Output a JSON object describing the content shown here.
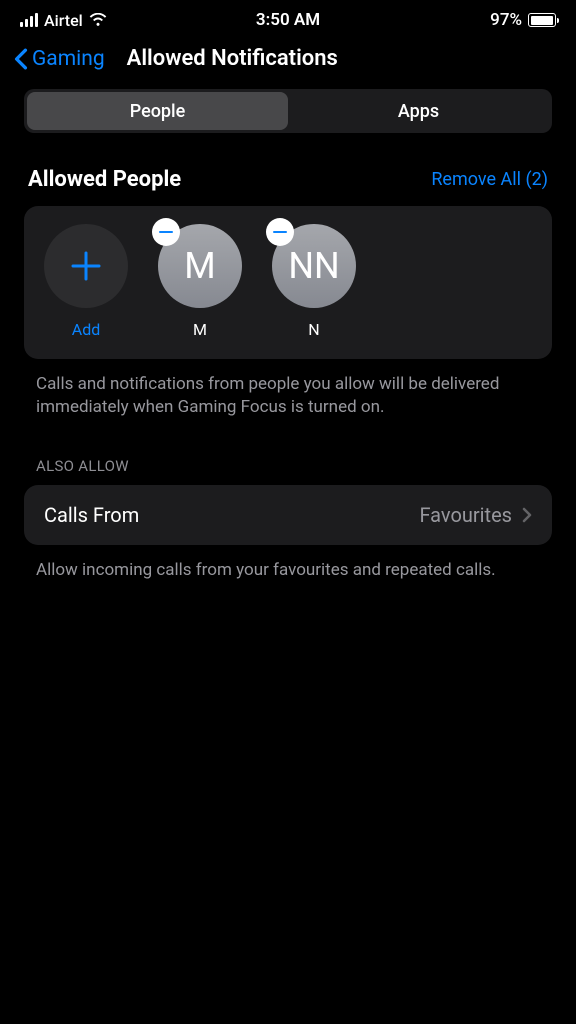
{
  "status": {
    "carrier": "Airtel",
    "time": "3:50 AM",
    "battery_pct": "97%",
    "battery_fill_width": "97%"
  },
  "nav": {
    "back_label": "Gaming",
    "title": "Allowed Notifications"
  },
  "segments": {
    "people": "People",
    "apps": "Apps"
  },
  "allowed_people": {
    "title": "Allowed People",
    "remove_all": "Remove All (2)",
    "add_label": "Add",
    "people": [
      {
        "initials": "M",
        "name": "M"
      },
      {
        "initials": "NN",
        "name": "N"
      }
    ],
    "description": "Calls and notifications from people you allow will be delivered immediately when Gaming Focus is turned on."
  },
  "also_allow": {
    "header": "ALSO ALLOW",
    "calls_from_label": "Calls From",
    "calls_from_value": "Favourites",
    "description": "Allow incoming calls from your favourites and repeated calls."
  },
  "colors": {
    "accent": "#0a84ff",
    "card_bg": "#1c1c1e",
    "segment_active": "#48484a",
    "text_secondary": "#98989e"
  }
}
